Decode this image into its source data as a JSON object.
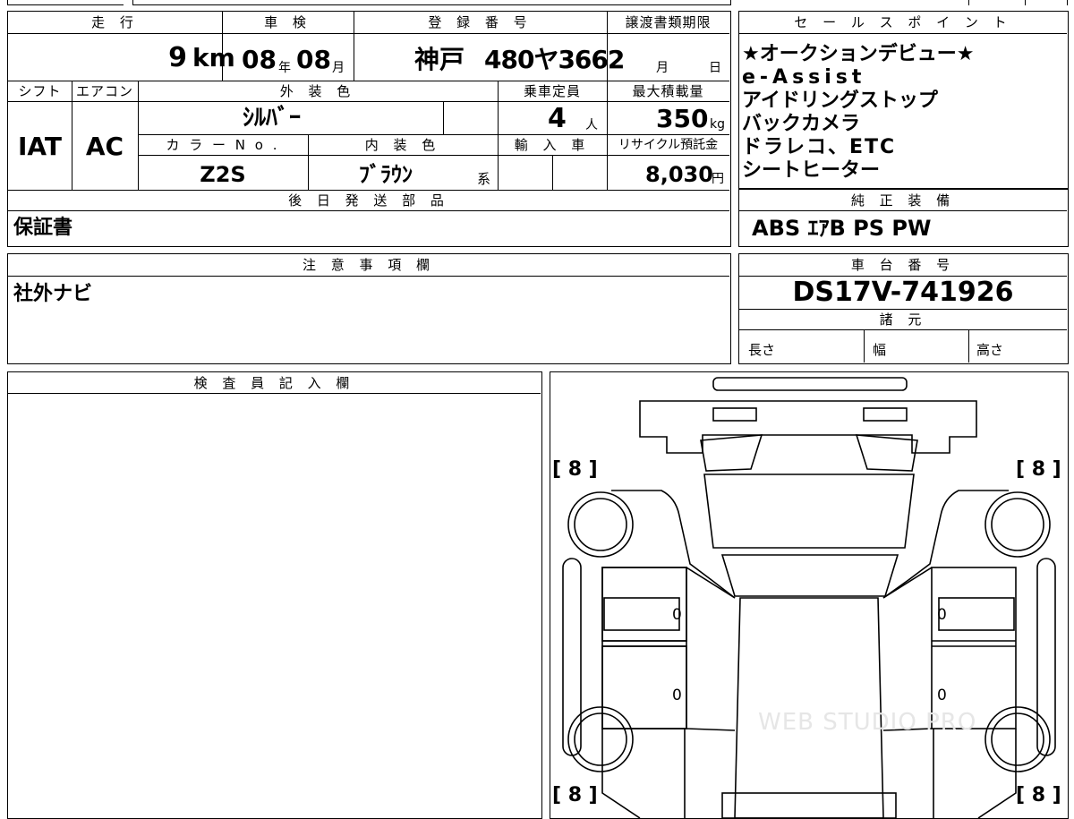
{
  "vehicle": {
    "mileage_header": "走 行",
    "mileage_value": "9",
    "mileage_unit": "km",
    "shaken_header": "車 検",
    "shaken_year": "08",
    "shaken_year_unit": "年",
    "shaken_month": "08",
    "shaken_month_unit": "月",
    "registration_header": "登 録 番 号",
    "registration_area": "神戸",
    "registration_number": "480ヤ3662",
    "transfer_header": "譲渡書類期限",
    "transfer_month_unit": "月",
    "transfer_day_unit": "日",
    "shift_header": "シフト",
    "shift_value": "IAT",
    "ac_header": "エアコン",
    "ac_value": "AC",
    "exterior_color_header": "外 装 色",
    "exterior_color_value": "ｼﾙﾊﾞｰ",
    "capacity_header": "乗車定員",
    "capacity_value": "4",
    "capacity_unit": "人",
    "max_load_header": "最大積載量",
    "max_load_value": "350",
    "max_load_unit": "kg",
    "color_no_header": "カ ラ ー N o .",
    "color_no_value": "Z2S",
    "interior_color_header": "内 装 色",
    "interior_color_value": "ﾌﾞﾗｳﾝ",
    "interior_color_suffix": "系",
    "import_header": "輸 入 車",
    "recycle_header": "リサイクル預託金",
    "recycle_value": "8,030",
    "recycle_unit": "円"
  },
  "sales_points": {
    "header": "セ ー ル ス ポ イ ン ト",
    "items": [
      "★オークションデビュー★",
      "e-Assist",
      "アイドリングストップ",
      "バックカメラ",
      "ドラレコ、ETC",
      "シートヒーター"
    ]
  },
  "later_shipment": {
    "header": "後 日 発 送 部 品",
    "value": "保証書"
  },
  "genuine_equipment": {
    "header": "純 正 装 備",
    "value": "ABS ｴｱB PS PW"
  },
  "notes": {
    "header": "注 意 事 項 欄",
    "value": "社外ナビ"
  },
  "chassis": {
    "header": "車 台 番 号",
    "value": "DS17V-741926"
  },
  "specs": {
    "header": "諸 元",
    "length_label": "長さ",
    "width_label": "幅",
    "height_label": "高さ"
  },
  "inspector": {
    "header": "検 査 員 記 入 欄"
  },
  "diagram": {
    "tread_top_left": "[ 8 ]",
    "tread_top_right": "[ 8 ]",
    "tread_bottom_left": "[ 8 ]",
    "tread_bottom_right": "[ 8 ]",
    "door_left_front": "0",
    "door_left_rear": "0",
    "door_right_front": "0",
    "door_right_rear": "0",
    "watermark": "WEB STUDIO PRO"
  }
}
